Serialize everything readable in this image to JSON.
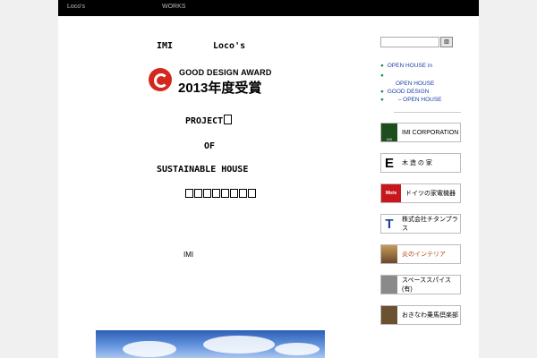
{
  "nav": {
    "items": [
      {
        "label": "Loco's"
      },
      {
        "label": "WORKS"
      }
    ]
  },
  "header": {
    "title_left": "IMI",
    "title_right": "Loco's"
  },
  "award": {
    "line1": "GOOD DESIGN AWARD",
    "line2": "2013年度受賞"
  },
  "main": {
    "project_line1": "PROJECT",
    "project_line2": "OF",
    "project_line3": "SUSTAINABLE HOUSE",
    "subtitle_glyphs": "",
    "body_label": "IMI"
  },
  "search": {
    "placeholder": "",
    "button_label": ""
  },
  "sidebar": {
    "links": [
      {
        "label": "OPEN HOUSE in"
      },
      {
        "label": ""
      },
      {
        "label": "OPEN HOUSE"
      },
      {
        "label": "GOOD DESIGN"
      },
      {
        "label": "– OPEN HOUSE"
      }
    ],
    "banners": [
      {
        "label": "IMI CORPORATION",
        "color": "#1e4d1e",
        "tag": "IMI"
      },
      {
        "label": "木 造 の 家",
        "color": "#111111"
      },
      {
        "label": "ドイツの家電機器",
        "color": "#c8161d",
        "tag": "Miele"
      },
      {
        "label": "株式会社チタンプラス",
        "color": "#1f3f99"
      },
      {
        "label": "炎のインテリア",
        "color": "#a5682a"
      },
      {
        "label": "スペーススパイス(有)",
        "color": "#8a8a8a"
      },
      {
        "label": "おきなわ乗馬倶楽部",
        "color": "#6a5230"
      }
    ]
  },
  "colors": {
    "topbar": "#000000",
    "link": "#1a3fa6",
    "award_red": "#d4281f"
  }
}
